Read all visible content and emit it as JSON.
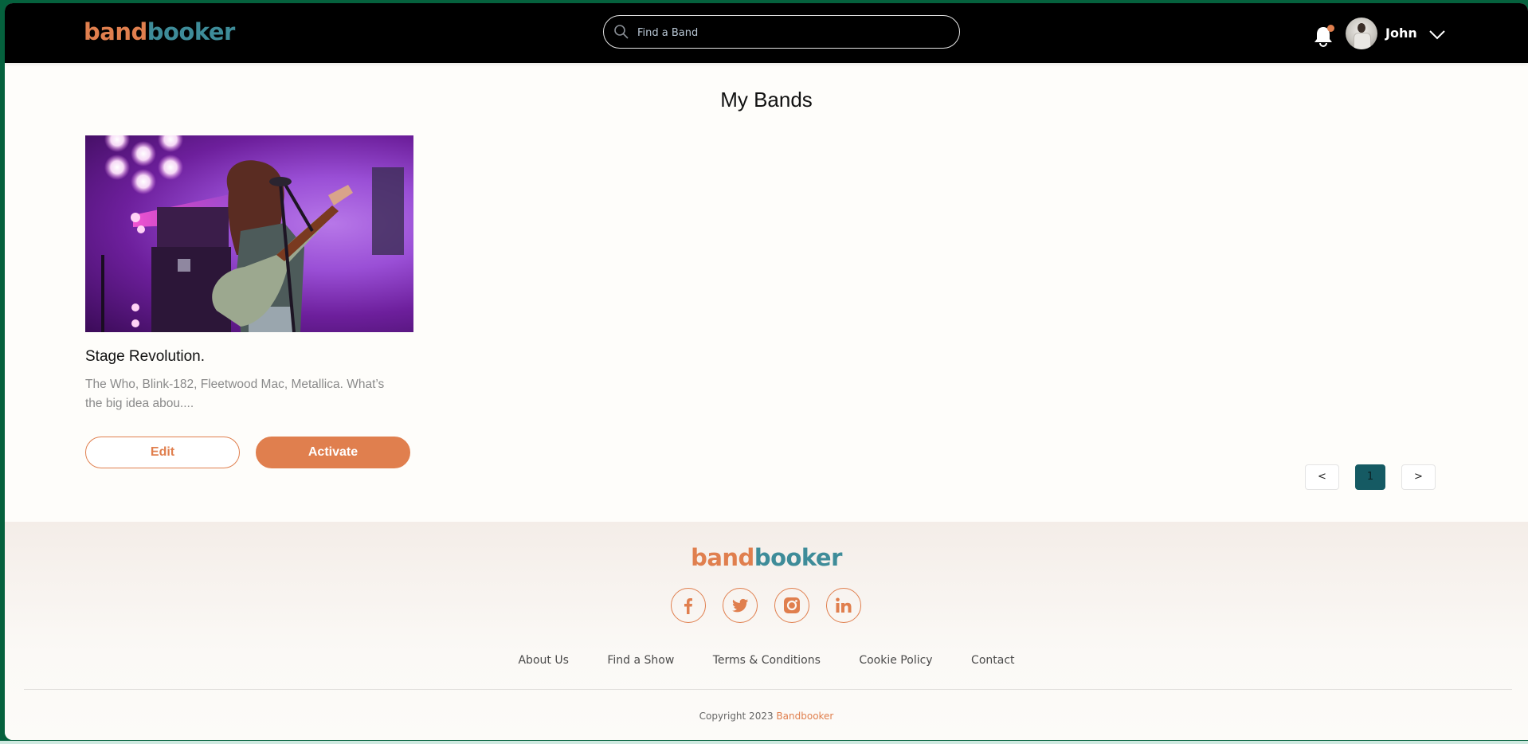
{
  "brand": {
    "logo_part1": "band",
    "logo_part2": "booker",
    "primary_color": "#e07f4e",
    "secondary_color": "#3e8c99",
    "accent_dark": "#155a63"
  },
  "header": {
    "search": {
      "placeholder": "Find a Band",
      "value": ""
    },
    "notification_icon": "bell-icon",
    "has_notification": true,
    "user": {
      "name": "John",
      "menu_icon": "chevron-down-icon"
    }
  },
  "main": {
    "title": "My Bands",
    "bands": [
      {
        "name": "Stage Revolution.",
        "description": "The Who, Blink-182, Fleetwood Mac, Metallica. What’s the big idea abou....",
        "image_alt": "Musician playing bass guitar on stage under purple lights",
        "edit_label": "Edit",
        "activate_label": "Activate"
      }
    ],
    "pagination": {
      "prev_label": "<",
      "current_page": "1",
      "next_label": ">"
    }
  },
  "footer": {
    "socials": [
      "facebook",
      "twitter",
      "instagram",
      "linkedin"
    ],
    "links": [
      "About Us",
      "Find a Show",
      "Terms & Conditions",
      "Cookie Policy",
      "Contact"
    ],
    "copyright_prefix": "Copyright 2023 ",
    "copyright_brand": "Bandbooker"
  }
}
